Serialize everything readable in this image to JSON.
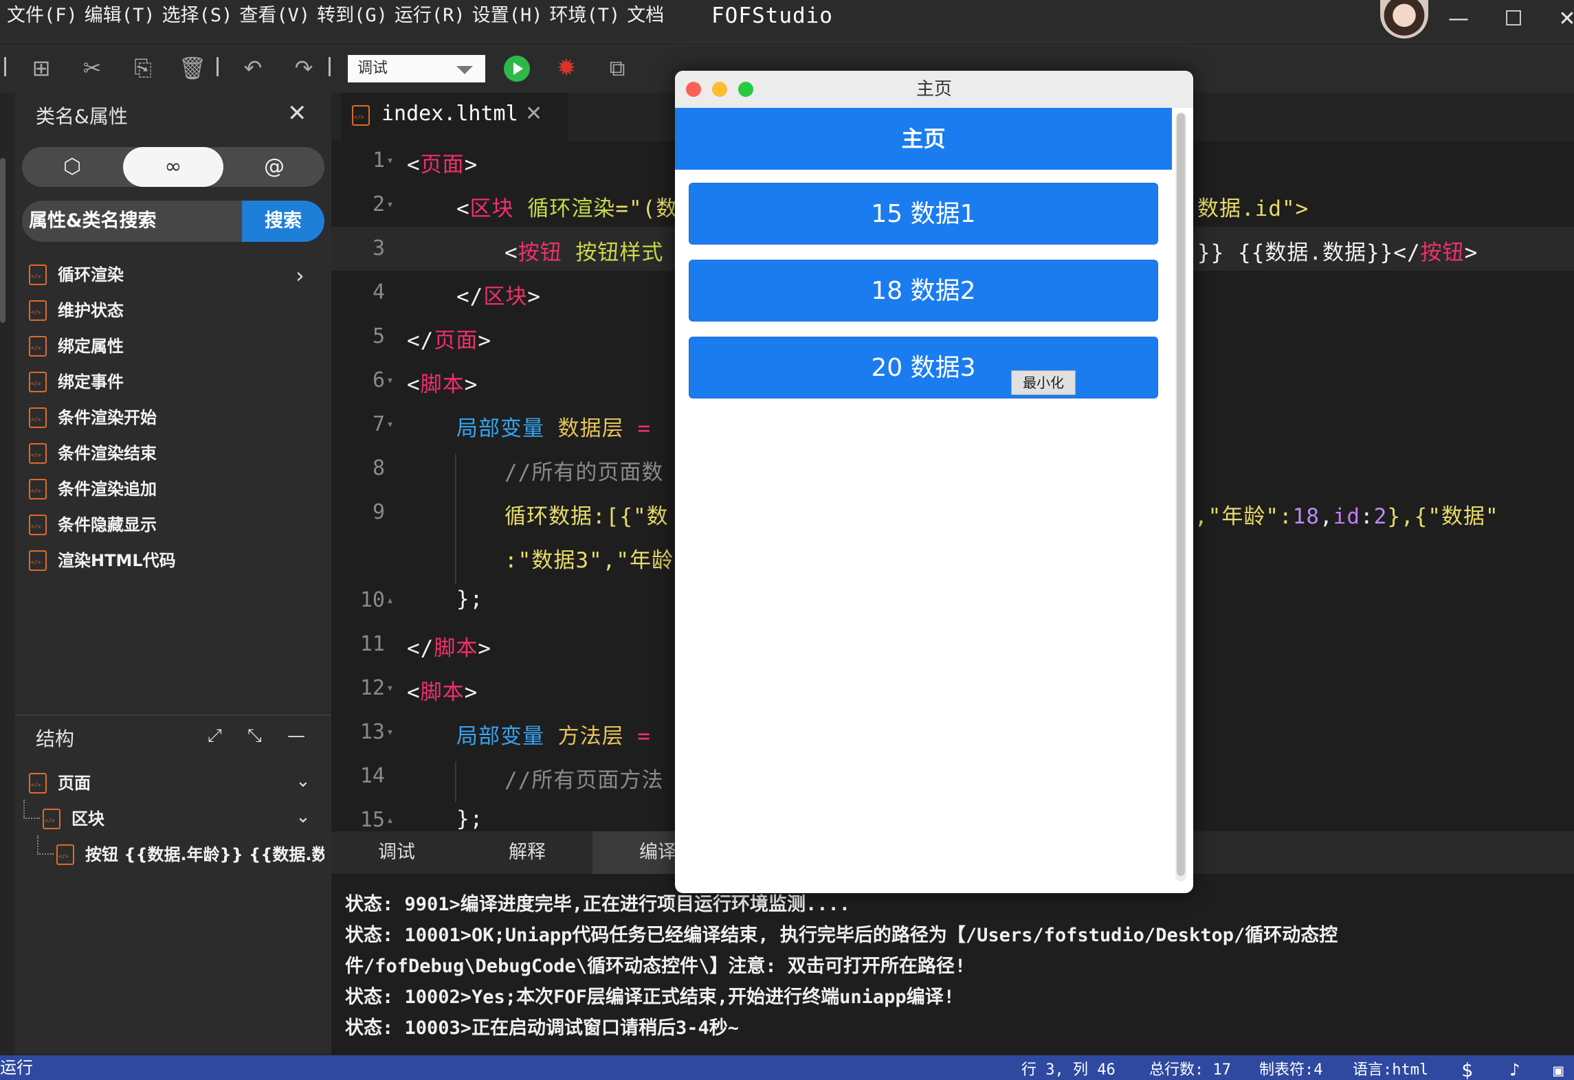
{
  "menubar": {
    "items": [
      "文件(F)",
      "编辑(T)",
      "选择(S)",
      "查看(V)",
      "转到(G)",
      "运行(R)",
      "设置(H)",
      "环境(T)",
      "文档"
    ],
    "app_title": "FOFStudio",
    "window_controls": {
      "minimize": "—",
      "maximize": "☐",
      "close": "✕"
    }
  },
  "toolbar": {
    "mode_value": "调试",
    "icons": [
      "new-file-icon",
      "cut-icon",
      "copy-icon",
      "delete-icon",
      "undo-icon",
      "redo-icon",
      "run-icon",
      "debug-bug-icon",
      "preview-search-icon"
    ]
  },
  "left_panel": {
    "title": "类名&属性",
    "segments": [
      "⬡",
      "∞",
      "@"
    ],
    "search_placeholder": "属性&类名搜索",
    "search_button": "搜索",
    "items": [
      "循环渲染",
      "维护状态",
      "绑定属性",
      "绑定事件",
      "条件渲染开始",
      "条件渲染结束",
      "条件渲染追加",
      "条件隐藏显示",
      "渲染HTML代码"
    ]
  },
  "structure": {
    "title": "结构",
    "nodes": [
      {
        "label": "页面"
      },
      {
        "label": "区块"
      },
      {
        "label": "按钮 {{数据.年龄}} {{数据.数"
      }
    ]
  },
  "editor": {
    "tab_label": "index.lhtml",
    "line_numbers": [
      "1",
      "2",
      "3",
      "4",
      "5",
      "6",
      "7",
      "8",
      "9",
      "",
      "10",
      "11",
      "12",
      "13",
      "14",
      "15"
    ],
    "lines": {
      "l1": [
        "<",
        "页面",
        ">"
      ],
      "l2a": [
        "<",
        "区块",
        " ",
        "循环渲染",
        "=\"(数"
      ],
      "l2b": "数据.id\">",
      "l3a": [
        "<",
        "按钮",
        " ",
        "按钮样式"
      ],
      "l3b": [
        "}} {{数据.数据}}</",
        "按钮",
        ">"
      ],
      "l4": [
        "</",
        "区块",
        ">"
      ],
      "l5": [
        "</",
        "页面",
        ">"
      ],
      "l6": [
        "<",
        "脚本",
        ">"
      ],
      "l7": [
        "局部变量",
        " ",
        "数据层",
        " ="
      ],
      "l8": "//所有的页面数",
      "l9a": "循环数据:[{\"数",
      "l9b": [
        ",\"年龄\":",
        "18",
        ",",
        "id",
        ":",
        "2",
        "},{\"数据\""
      ],
      "l9c": ":\"数据3\",\"年龄",
      "l10": "};",
      "l11": [
        "</",
        "脚本",
        ">"
      ],
      "l12": [
        "<",
        "脚本",
        ">"
      ],
      "l13": [
        "局部变量",
        " ",
        "方法层",
        " ="
      ],
      "l14": "//所有页面方法",
      "l15": "};"
    }
  },
  "bottom_panel": {
    "tabs": [
      "调试",
      "解释",
      "编译"
    ],
    "console": [
      "状态: 9901>编译进度完毕,正在进行项目运行环境监测....",
      "状态: 10001>OK;Uniapp代码任务已经编译结束, 执行完毕后的路径为【/Users/fofstudio/Desktop/循环动态控",
      "件/fofDebug\\DebugCode\\循环动态控件\\】注意: 双击可打开所在路径!",
      "状态: 10002>Yes;本次FOF层编译正式结束,开始进行终端uniapp编译!",
      "状态: 10003>正在启动调试窗口请稍后3-4秒~"
    ]
  },
  "statusbar": {
    "left": "运行",
    "position": "行 3, 列 46",
    "total_lines": "总行数: 17",
    "tab_size": "制表符:4",
    "language": "语言:html"
  },
  "preview": {
    "window_title": "主页",
    "header": "主页",
    "buttons": [
      "15 数据1",
      "18 数据2",
      "20 数据3"
    ],
    "tooltip": "最小化",
    "colors": {
      "accent": "#1b7cf0",
      "close": "#fe5f57",
      "minimize": "#febc2e",
      "zoom": "#28c840"
    }
  }
}
